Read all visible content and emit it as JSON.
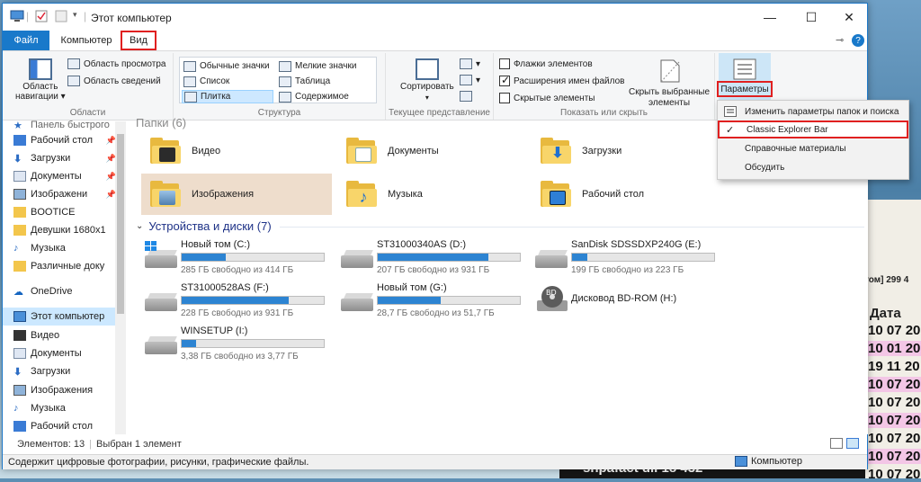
{
  "window": {
    "title": "Этот компьютер",
    "min_glyph": "—",
    "max_glyph": "☐",
    "close_glyph": "✕"
  },
  "menu": {
    "file": "Файл",
    "computer": "Компьютер",
    "view": "Вид"
  },
  "ribbon": {
    "groups": {
      "panes": "Области",
      "layout": "Структура",
      "current_view": "Текущее представление",
      "show_hide": "Показать или скрыть"
    },
    "nav_pane": {
      "line1": "Область",
      "line2": "навигации"
    },
    "preview_pane": "Область просмотра",
    "details_pane": "Область сведений",
    "layout": [
      "Обычные значки",
      "Мелкие значки",
      "Список",
      "Таблица",
      "Плитка",
      "Содержимое"
    ],
    "sort": "Сортировать",
    "checkboxes": [
      {
        "label": "Флажки элементов",
        "checked": false
      },
      {
        "label": "Расширения имен файлов",
        "checked": true
      },
      {
        "label": "Скрытые элементы",
        "checked": false
      }
    ],
    "hide_selected": {
      "line1": "Скрыть выбранные",
      "line2": "элементы"
    },
    "params": "Параметры"
  },
  "dropdown": {
    "items": [
      "Изменить параметры папок и поиска",
      "Classic Explorer Bar",
      "Справочные материалы",
      "Обсудить"
    ],
    "checked_index": 1
  },
  "nav": {
    "quick_access": "Панель быстрого",
    "items": [
      "Рабочий стол",
      "Загрузки",
      "Документы",
      "Изображени",
      "BOOTICE",
      "Девушки 1680x1",
      "Музыка",
      "Различные доку",
      "OneDrive",
      "Этот компьютер",
      "Видео",
      "Документы",
      "Загрузки",
      "Изображения",
      "Музыка",
      "Рабочий стол"
    ]
  },
  "folders_header": "Папки (6)",
  "folders": [
    "Видео",
    "Документы",
    "Загрузки",
    "Изображения",
    "Музыка",
    "Рабочий стол"
  ],
  "devices_header": "Устройства и диски (7)",
  "drives": [
    {
      "name": "Новый том (C:)",
      "free": "285 ГБ свободно из 414 ГБ",
      "used_fraction": 0.31
    },
    {
      "name": "ST31000340AS (D:)",
      "free": "207 ГБ свободно из 931 ГБ",
      "used_fraction": 0.78
    },
    {
      "name": "SanDisk SDSSDXP240G (E:)",
      "free": "199 ГБ свободно из 223 ГБ",
      "used_fraction": 0.11
    },
    {
      "name": "ST31000528AS (F:)",
      "free": "228 ГБ свободно из 931 ГБ",
      "used_fraction": 0.75
    },
    {
      "name": "Новый том (G:)",
      "free": "28,7 ГБ свободно из 51,7 ГБ",
      "used_fraction": 0.44
    },
    {
      "name": "Дисковод BD-ROM (H:)",
      "free": "",
      "used_fraction": null
    },
    {
      "name": "WINSETUP (I:)",
      "free": "3,38 ГБ свободно из 3,77 ГБ",
      "used_fraction": 0.1
    }
  ],
  "status": {
    "count": "Элементов: 13",
    "selected": "Выбран 1 элемент"
  },
  "infobar": {
    "text": "Содержит цифровые фотографии, рисунки, графические файлы.",
    "location": "Компьютер"
  },
  "background": {
    "header": "том]  299 4",
    "date_header": "Дата",
    "rows": [
      "10 07 20",
      "10 01 20",
      "19 11 20",
      "10 07 20",
      "10 07 20",
      "10 07 20",
      "10 07 20",
      "10 07 20",
      "10 07 20"
    ],
    "bottom": "snpafact          dll        18 432"
  },
  "colors": {
    "accent": "#1979ca",
    "highlight": "#e02020",
    "selection": "#cce8ff",
    "drive_bar": "#2d84d2"
  }
}
